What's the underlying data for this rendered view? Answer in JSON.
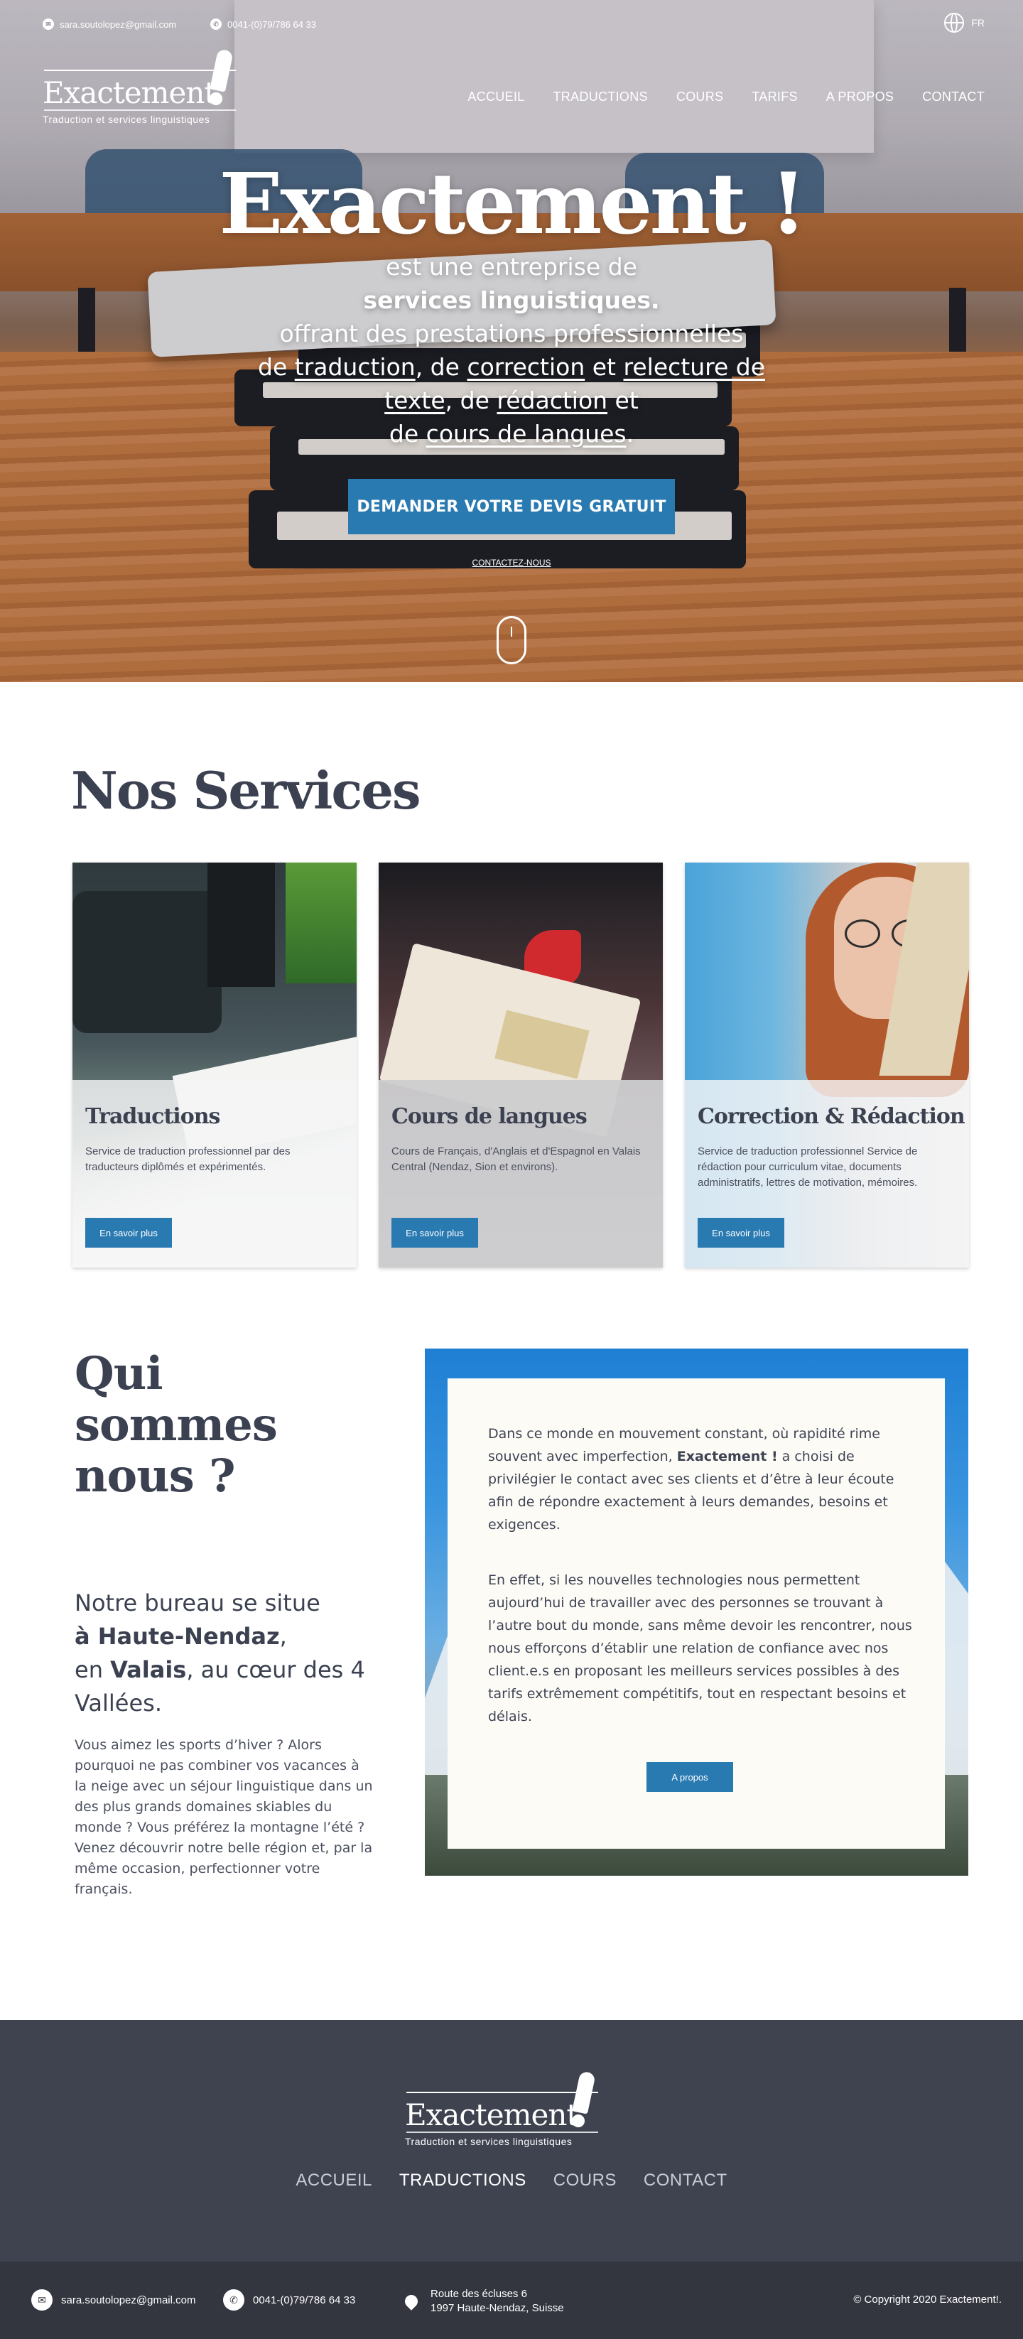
{
  "topbar": {
    "email": "sara.soutolopez@gmail.com",
    "phone": "0041-(0)79/786 64 33",
    "language": "FR",
    "icons": {
      "email": "envelope-icon",
      "phone": "phone-icon",
      "language": "globe-icon"
    }
  },
  "logo": {
    "word": "Exactement",
    "tagline": "Traduction et services linguistiques"
  },
  "nav": {
    "items": [
      "ACCUEIL",
      "TRADUCTIONS",
      "COURS",
      "TARIFS",
      "A PROPOS",
      "CONTACT"
    ]
  },
  "hero": {
    "title": "Exactement !",
    "line1": "est une entreprise de",
    "line2": "services linguistiques.",
    "line3": "offrant des prestations professionnelles",
    "line4_prefix": "de ",
    "line4_link1": "traduction",
    "line4_mid": ", de ",
    "line4_link2": "correction",
    "line4_mid2": " et ",
    "line4_link3": "relecture de",
    "line5_link": "texte",
    "line5_mid": ", de ",
    "line5_link2": "rédaction",
    "line5_suffix": " et",
    "line6_prefix": "de ",
    "line6_link": "cours de langues",
    "line6_suffix": ".",
    "cta": "DEMANDER VOTRE DEVIS GRATUIT",
    "contact_link": "CONTACTEZ-NOUS"
  },
  "services": {
    "title": "Nos Services",
    "cards": [
      {
        "title": "Traductions",
        "text": "Service de traduction professionnel par des traducteurs diplômés et expérimentés.",
        "button": "En savoir plus"
      },
      {
        "title": "Cours de langues",
        "text": "Cours de Français, d'Anglais et d'Espagnol en Valais Central (Nendaz, Sion et environs).",
        "button": "En savoir plus"
      },
      {
        "title": "Correction & Rédaction",
        "text": "Service de traduction professionnel Service de rédaction pour curriculum vitae, documents administratifs, lettres de motivation, mémoires.",
        "button": "En savoir plus"
      }
    ]
  },
  "about": {
    "title": "Qui sommes nous ?",
    "lead_1": "Notre bureau se situe",
    "lead_2": "à Haute-Nendaz",
    "lead_3": ",",
    "lead_4": "en ",
    "lead_5": "Valais",
    "lead_6": ", au cœur des 4 Vallées.",
    "text": "Vous aimez les sports d’hiver ? Alors pourquoi ne pas combiner vos vacances à la neige avec un séjour linguistique dans un des plus grands domaines skiables du monde ? Vous préférez la montagne l’été ? Venez découvrir notre belle région et, par la même occasion, perfectionner votre français.",
    "box_p1_a": "Dans ce monde en mouvement constant, où rapidité rime souvent avec imperfection, ",
    "box_p1_b": "Exactement !",
    "box_p1_c": " a choisi de privilégier le contact avec ses clients et d’être à leur écoute afin de répondre exactement à leurs demandes, besoins et exigences.",
    "box_p2": "En effet, si les nouvelles technologies nous permettent aujourd’hui de travailler avec des personnes se trouvant à l’autre bout du monde, sans même devoir les rencontrer, nous nous efforçons d’établir une relation de confiance avec nos client.e.s en proposant les meilleurs services possibles à des tarifs extrêmement compétitifs, tout en respectant besoins et délais.",
    "button": "A propos"
  },
  "footer": {
    "nav": [
      "ACCUEIL",
      "TRADUCTIONS",
      "COURS",
      "CONTACT"
    ],
    "active": "TRADUCTIONS",
    "email": "sara.soutolopez@gmail.com",
    "phone": "0041-(0)79/786 64 33",
    "address_1": "Route des écluses 6",
    "address_2": "1997 Haute-Nendaz, Suisse",
    "copyright": "© Copyright 2020 Exactement!.",
    "icons": {
      "email": "envelope-icon",
      "phone": "phone-icon",
      "address": "map-pin-icon"
    }
  },
  "colors": {
    "accent": "#2a7ab2",
    "text": "#3b4150",
    "footer_bg": "#3f4350",
    "bottombar_bg": "#33363f"
  }
}
